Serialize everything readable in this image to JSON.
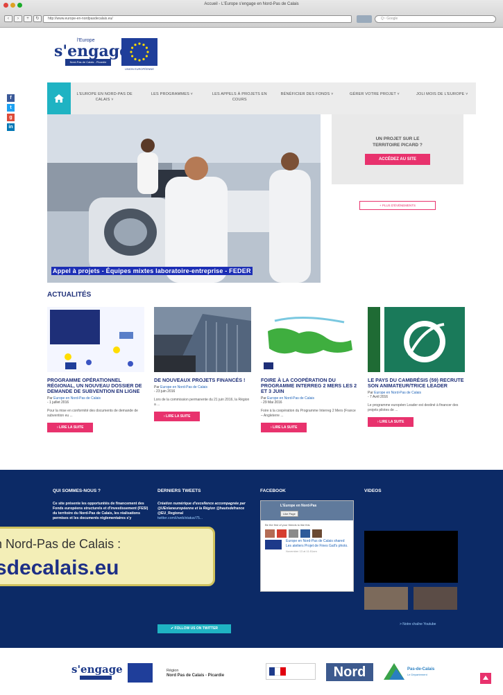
{
  "window": {
    "title": "Accueil - L'Europe s'engage en Nord-Pas de Calais",
    "url": "http://www.europe-en-nordpasdecalais.eu/",
    "search_placeholder": "Q~ Google"
  },
  "header": {
    "logo_small": "l'Europe",
    "logo_word": "s'engage",
    "logo_band": "Nord-Pas de Calais - Picardie",
    "eu_caption": "UNION EUROPÉENNE"
  },
  "share": [
    {
      "label": "f",
      "color": "#3b5998"
    },
    {
      "label": "t",
      "color": "#1da1f2"
    },
    {
      "label": "g",
      "color": "#dd4b39"
    },
    {
      "label": "in",
      "color": "#0077b5"
    }
  ],
  "nav": {
    "home_icon": "home-icon",
    "items": [
      "L'EUROPE EN NORD-PAS DE CALAIS ˅",
      "LES PROGRAMMES ˅",
      "LES APPELS À PROJETS EN COURS",
      "BÉNÉFICIER DES FONDS ˅",
      "GÉRER VOTRE PROJET ˅",
      "JOLI MOIS DE L'EUROPE ˅"
    ]
  },
  "hero": {
    "caption": "Appel à projets - Équipes mixtes laboratoire-entreprise - FEDER"
  },
  "promo": {
    "text_line1": "UN PROJET SUR LE",
    "text_line2": "TERRITOIRE PICARD ?",
    "button": "ACCÉDEZ AU SITE",
    "events_button": "+ PLUS D'ÉVÉNEMENTS"
  },
  "news": {
    "heading": "ACTUALITÉS",
    "cards": [
      {
        "title": "PROGRAMME OPÉRATIONNEL RÉGIONAL, UN NOUVEAU DOSSIER DE DEMANDE DE SUBVENTION EN LIGNE",
        "by": "Par",
        "author": "Europe en Nord-Pas de Calais",
        "date": "- 1 juillet 2016",
        "excerpt": "Pour la mise en conformité des documents de demande de subvention eu ...",
        "button": "›  LIRE LA SUITE"
      },
      {
        "title": "DE NOUVEAUX PROJETS FINANCÉS !",
        "by": "Par",
        "author": "Europe en Nord-Pas de Calais",
        "date": "- 23 juin 2016",
        "excerpt": "Lors de la commission permanente du 21 juin 2016, la Région a ...",
        "button": "›  LIRE LA SUITE"
      },
      {
        "title": "FOIRE À LA COOPÉRATION DU PROGRAMME INTERREG 2 MERS LES 2 ET 3 JUIN",
        "by": "Par",
        "author": "Europe en Nord-Pas de Calais",
        "date": "- 29 Mai 2016",
        "excerpt": "Foire à la coopération du Programme Interreg 2 Mers (France – Angleterre ...",
        "button": "›  LIRE LA SUITE"
      },
      {
        "title": "LE PAYS DU CAMBRÉSIS (59) RECRUTE SON ANIMATEUR/TRICE LEADER",
        "by": "Par",
        "author": "Europe en Nord-Pas de Calais",
        "date": "- 7 Avril 2016",
        "excerpt": "Le programme européen Leader est destiné à financer des projets pilotes de ...",
        "button": "›  LIRE LA SUITE"
      }
    ]
  },
  "footer": {
    "about": {
      "heading": "QUI SOMMES-NOUS ?",
      "body": "Ce site présente les opportunités de financement des Fonds européens structurels et d'investissement (FESI) du territoire du Nord-Pas de Calais, les réalisations permises et les documents réglementaires s'y"
    },
    "tweets": {
      "heading": "DERNIERS TWEETS",
      "tweet1": "Création numérique d'excellence accompagnée par @UEnlaneuropéenne et la Région @hautsdefrance",
      "handle": "@EU_Regional",
      "link": "twitter.com/i/web/status/75...",
      "follow": "✔  FOLLOW US ON TWITTER"
    },
    "facebook": {
      "heading": "FACEBOOK",
      "page_name": "L'Europe en Nord-Pas",
      "like": "Like Page",
      "line": "Be the first of your friends to like this",
      "post": "Europe en Nord-Pas de Calais shared Les ateliers Projet de Fines Gall's photo.",
      "post_time": "November 13 at 11:51am"
    },
    "videos": {
      "heading": "VIDEOS",
      "link": "> Notre chaîne Youtube"
    }
  },
  "banner": {
    "line1": "n Nord-Pas de Calais :",
    "line2": "sdecalais.eu"
  },
  "bottom": {
    "region_line1": "Région",
    "region_line2": "Nord Pas de Calais - Picardie",
    "nord": "Nord",
    "pdc": "Pas-de-Calais",
    "pdc_sub": "Le Département"
  },
  "colors": {
    "accent_pink": "#e8326d",
    "accent_teal": "#1fb3c3",
    "navy": "#0c2a66",
    "title_blue": "#1e2f78"
  }
}
